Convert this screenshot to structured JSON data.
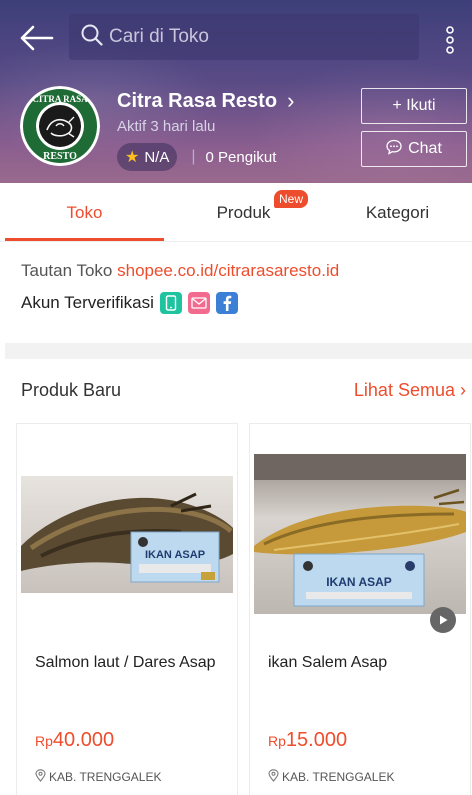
{
  "header": {
    "search_placeholder": "Cari di Toko",
    "shop_name": "Citra Rasa Resto",
    "active_status": "Aktif 3 hari lalu",
    "rating": "N/A",
    "followers": "0 Pengikut",
    "follow_label": "+ Ikuti",
    "chat_label": "Chat",
    "logo_text_top": "CITRA RASA",
    "logo_text_bottom": "RESTO"
  },
  "tabs": {
    "items": [
      "Toko",
      "Produk",
      "Kategori"
    ],
    "active": "Toko",
    "new_badge": "New"
  },
  "shop_info": {
    "link_label": "Tautan Toko",
    "link_url": "shopee.co.id/citrarasaresto.id",
    "verified_label": "Akun Terverifikasi",
    "verified_icons": [
      "phone-icon",
      "email-icon",
      "facebook-icon"
    ]
  },
  "products_section": {
    "title": "Produk Baru",
    "see_all": "Lihat Semua",
    "products": [
      {
        "name": "Salmon laut / Dares Asap",
        "currency": "Rp",
        "price": "40.000",
        "location": "KAB. TRENGGALEK",
        "label_text": "IKAN ASAP"
      },
      {
        "name": "ikan Salem Asap",
        "currency": "Rp",
        "price": "15.000",
        "location": "KAB. TRENGGALEK",
        "label_text": "IKAN ASAP"
      }
    ]
  },
  "colors": {
    "accent": "#ee4d2d",
    "header_top": "#3d3f7a",
    "header_bottom": "#9a6a8e"
  }
}
